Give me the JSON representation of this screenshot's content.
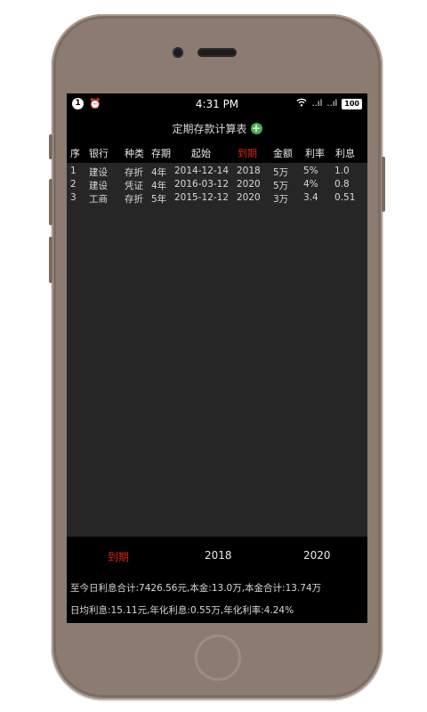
{
  "status": {
    "notification_count": "1",
    "time": "4:31 PM",
    "signal1": "..ıl",
    "signal2": "..ıl",
    "battery": "100"
  },
  "title": "定期存款计算表",
  "table": {
    "headers": [
      "序",
      "银行",
      "种类",
      "存期",
      "起始",
      "到期",
      "金额",
      "利率",
      "利息"
    ],
    "rows": [
      [
        "1",
        "建设",
        "存折",
        "4年",
        "2014-12-14",
        "2018",
        "5万",
        "5%",
        "1.0"
      ],
      [
        "2",
        "建设",
        "凭证",
        "4年",
        "2016-03-12",
        "2020",
        "5万",
        "4%",
        "0.8"
      ],
      [
        "3",
        "工商",
        "存折",
        "5年",
        "2015-12-12",
        "2020",
        "3万",
        "3.4",
        "0.51"
      ]
    ]
  },
  "bottom": {
    "label": "到期",
    "value1": "2018",
    "value2": "2020"
  },
  "summary": {
    "line1": "至今日利息合计:7426.56元,本金:13.0万,本金合计:13.74万",
    "line2": "日均利息:15.11元,年化利息:0.55万,年化利率:4.24%"
  },
  "colors": {
    "highlight": "#d9261c",
    "add_button": "#3fb54a",
    "phone_body": "#8b7b70"
  }
}
